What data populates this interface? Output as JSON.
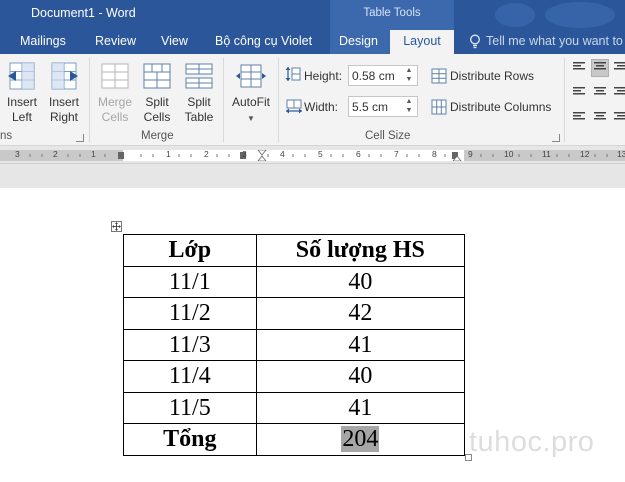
{
  "window": {
    "title": "Document1 - Word",
    "context_group": "Table Tools"
  },
  "tabs": {
    "items": [
      "Mailings",
      "Review",
      "View",
      "Bộ công cụ Violet",
      "Design"
    ],
    "active": "Layout",
    "tell_me": "Tell me what you want to do"
  },
  "ribbon": {
    "group_partial_label": "ns",
    "insert_left": [
      "Insert",
      "Left"
    ],
    "insert_right": [
      "Insert",
      "Right"
    ],
    "merge_cells": [
      "Merge",
      "Cells"
    ],
    "split_cells": [
      "Split",
      "Cells"
    ],
    "split_table": [
      "Split",
      "Table"
    ],
    "merge_group_label": "Merge",
    "autofit": "AutoFit",
    "height_label": "Height:",
    "height_value": "0.58 cm",
    "width_label": "Width:",
    "width_value": "5.5 cm",
    "distribute_rows": "Distribute Rows",
    "distribute_columns": "Distribute Columns",
    "cell_size_label": "Cell Size"
  },
  "ruler": {
    "labels": [
      "3",
      "2",
      "1",
      "1",
      "2",
      "3",
      "4",
      "5",
      "6",
      "7",
      "8",
      "9",
      "10",
      "11",
      "12",
      "13"
    ]
  },
  "table": {
    "header": [
      "Lớp",
      "Số lượng HS"
    ],
    "rows": [
      [
        "11/1",
        "40"
      ],
      [
        "11/2",
        "42"
      ],
      [
        "11/3",
        "41"
      ],
      [
        "11/4",
        "40"
      ],
      [
        "11/5",
        "41"
      ]
    ],
    "total": [
      "Tổng",
      "204"
    ]
  },
  "watermark": "tuhoc.pro",
  "colors": {
    "word_blue": "#2b579a",
    "context_blue": "#3c69ad",
    "ribbon_bg": "#f3f3f3",
    "selection_grey": "#a6a6a6"
  }
}
